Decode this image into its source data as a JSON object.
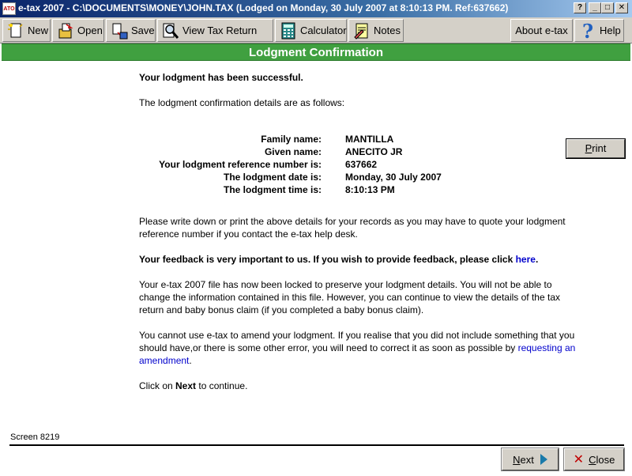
{
  "window": {
    "title": "e-tax 2007 - C:\\DOCUMENTS\\MONEY\\JOHN.TAX (Lodged on Monday, 30 July 2007 at 8:10:13 PM.  Ref:637662)",
    "app_icon_text": "ATO",
    "help_btn": "?",
    "min_btn": "_",
    "max_btn": "□",
    "close_btn": "✕"
  },
  "toolbar": {
    "new_label": "New",
    "open_label": "Open",
    "save_label": "Save",
    "view_label": "View Tax Return",
    "calculator_label": "Calculator",
    "notes_label": "Notes",
    "about_label": "About e-tax",
    "help_label": "Help"
  },
  "header": {
    "title": "Lodgment Confirmation"
  },
  "content": {
    "success": "Your lodgment has been successful.",
    "intro": "The lodgment confirmation details are as follows:",
    "details": [
      {
        "label": "Family name:",
        "value": "MANTILLA"
      },
      {
        "label": "Given name:",
        "value": "ANECITO JR"
      },
      {
        "label": "Your lodgment reference number is:",
        "value": "637662"
      },
      {
        "label": "The lodgment date is:",
        "value": "Monday, 30 July 2007"
      },
      {
        "label": "The lodgment time is:",
        "value": "8:10:13 PM"
      }
    ],
    "print_label": "Print",
    "write_down": "Please write down or print the above details for your records as you may have to quote your lodgment reference number if you contact the e-tax help desk.",
    "feedback_text": "Your feedback is very important to us. If you wish to provide feedback, please click ",
    "feedback_link": "here",
    "feedback_end": ".",
    "locked": "Your e-tax 2007 file has now been locked to preserve your lodgment details. You will not be able to change the information contained in this file. However, you can continue to view the details of the tax return and baby bonus claim (if you completed a baby bonus claim).",
    "amend_text": "You cannot use e-tax to amend your lodgment. If you realise that you did not include something that you should have,or there is some other error, you will need to correct it as soon as possible by ",
    "amend_link": "requesting an amendment",
    "amend_end": ".",
    "continue_pre": "Click on ",
    "continue_bold": "Next",
    "continue_post": " to continue."
  },
  "footer": {
    "screen_id": "Screen 8219",
    "next_label": "Next",
    "close_label": "Close"
  }
}
